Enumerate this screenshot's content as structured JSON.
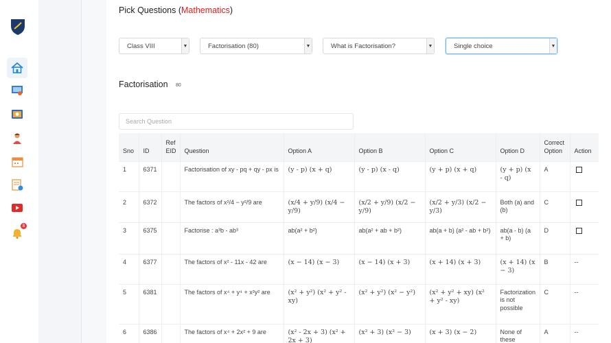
{
  "colors": {
    "accent": "#e21b1b",
    "focus": "#6fb7e9",
    "logo": "#1b3a6b"
  },
  "sidebar": {
    "icons": [
      "shield-logo-icon",
      "home-icon",
      "classroom-icon",
      "video-class-icon",
      "teacher-icon",
      "calendar-icon",
      "report-icon",
      "youtube-icon",
      "bell-icon"
    ],
    "notification_badge": "8"
  },
  "header": {
    "title_prefix": "Pick Questions (",
    "subject": "Mathematics",
    "title_suffix": ")"
  },
  "filters": {
    "class": "Class VIII",
    "chapter": "Factorisation (80)",
    "topic": "What is Factorisation?",
    "type": "Single choice"
  },
  "section": {
    "title": "Factorisation",
    "count": "80"
  },
  "search": {
    "placeholder": "Search Question"
  },
  "table": {
    "headers": {
      "sno": "Sno",
      "id": "ID",
      "ref": "Ref EID",
      "question": "Question",
      "a": "Option A",
      "b": "Option B",
      "c": "Option C",
      "d": "Option D",
      "correct": "Correct Option",
      "action": "Action"
    },
    "rows": [
      {
        "sno": "1",
        "id": "6371",
        "question": "Factorisation of xy - pq + qy - px is",
        "a": "(y - p) (x + q)",
        "b": "(y - p) (x - q)",
        "c": "(y + p) (x + q)",
        "d": "(y + p) (x - q)",
        "correct": "A",
        "action": ""
      },
      {
        "sno": "2",
        "id": "6372",
        "question": "The factors of x²/4 − y²/9 are",
        "a": "(x/4 + y/9) (x/4 − y/9)",
        "b": "(x/2 + y/9) (x/2 − y/9)",
        "c": "(x/2 + y/3) (x/2 − y/3)",
        "d": "Both (a) and (b)",
        "correct": "C",
        "action": ""
      },
      {
        "sno": "3",
        "id": "6375",
        "question": "Factorise : a³b - ab³",
        "a": "ab(a² + b²)",
        "b": "ab(a² + ab + b²)",
        "c": "ab(a + b) (a² - ab + b²)",
        "d": "ab(a - b) (a + b)",
        "correct": "D",
        "action": ""
      },
      {
        "sno": "4",
        "id": "6377",
        "question": "The factors of x² - 11x - 42 are",
        "a": "(x − 14) (x − 3)",
        "b": "(x − 14) (x + 3)",
        "c": "(x + 14) (x + 3)",
        "d": "(x + 14) (x − 3)",
        "correct": "B",
        "action": "--"
      },
      {
        "sno": "5",
        "id": "6381",
        "question": "The factors of x⁴ + y⁴ + x²y² are",
        "a": "(x² + y²) (x² + y² - xy)",
        "b": "(x² + y²) (x² − y²)",
        "c": "(x² + y² + xy) (x² + y² - xy)",
        "d": "Factorization is not possible",
        "correct": "C",
        "action": "--"
      },
      {
        "sno": "6",
        "id": "6386",
        "question": "The factors of x⁴ + 2x² + 9 are",
        "a": "(x² - 2x + 3) (x² + 2x + 3)",
        "b": "(x² + 3) (x² − 3)",
        "c": "(x + 3) (x − 2)",
        "d": "None of these",
        "correct": "A",
        "action": "--"
      }
    ]
  }
}
